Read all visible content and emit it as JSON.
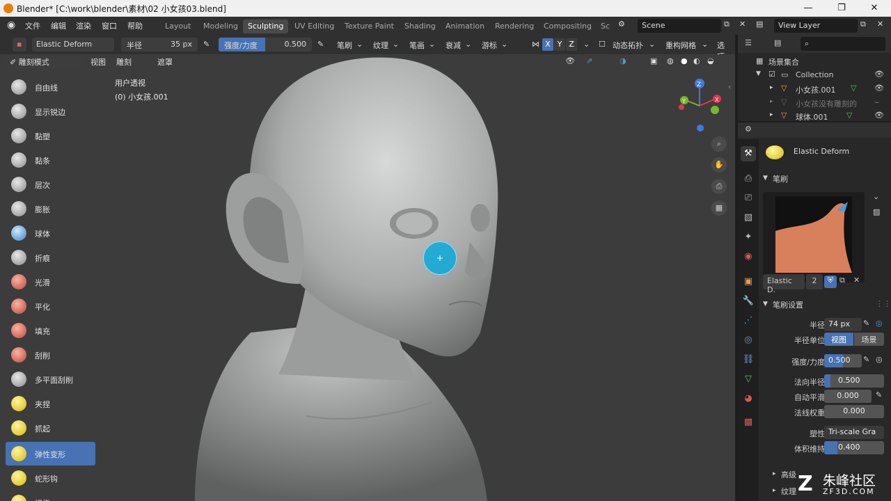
{
  "titlebar": {
    "title": "Blender* [C:\\work\\blender\\素材\\02 小女孩03.blend]",
    "min": "—",
    "max": "❐",
    "close": "✕"
  },
  "menu": [
    "文件",
    "编辑",
    "渲染",
    "窗口",
    "帮助"
  ],
  "workspaces": [
    "Layout",
    "Modeling",
    "Sculpting",
    "UV Editing",
    "Texture Paint",
    "Shading",
    "Animation",
    "Rendering",
    "Compositing",
    "Sc"
  ],
  "scene": "Scene",
  "view_layer": "View Layer",
  "tool_header": {
    "brush_name": "Elastic Deform",
    "radius_label": "半径",
    "radius_value": "35 px",
    "strength_label": "强度/力度",
    "strength_value": "0.500",
    "strength_fraction": 0.5,
    "dropdowns": [
      "笔刷",
      "纹理",
      "笔画",
      "衰减",
      "游标"
    ],
    "axes": [
      "X",
      "Y",
      "Z"
    ],
    "dyntopo": "动态拓扑",
    "remesh": "重构网格",
    "options": "选项"
  },
  "view_header": {
    "mode": "雕刻模式",
    "menus": [
      "视图",
      "雕刻",
      "遮罩"
    ]
  },
  "viewport": {
    "view_name": "用户透视",
    "object_name": "(0) 小女孩.001"
  },
  "tools": [
    {
      "label": "自由线",
      "icon": "draw-icon"
    },
    {
      "label": "显示锐边",
      "icon": "draw-sharp-icon"
    },
    {
      "label": "黏塑",
      "icon": "clay-icon"
    },
    {
      "label": "黏条",
      "icon": "clay-strips-icon"
    },
    {
      "label": "层次",
      "icon": "layer-icon"
    },
    {
      "label": "膨胀",
      "icon": "inflate-icon"
    },
    {
      "label": "球体",
      "icon": "blob-icon"
    },
    {
      "label": "折痕",
      "icon": "crease-icon"
    },
    {
      "label": "光滑",
      "icon": "smooth-icon"
    },
    {
      "label": "平化",
      "icon": "flatten-icon"
    },
    {
      "label": "填充",
      "icon": "fill-icon"
    },
    {
      "label": "刮削",
      "icon": "scrape-icon"
    },
    {
      "label": "多平面刮削",
      "icon": "multiplane-scrape-icon"
    },
    {
      "label": "夹捏",
      "icon": "pinch-icon"
    },
    {
      "label": "抓起",
      "icon": "grab-icon"
    },
    {
      "label": "弹性变形",
      "icon": "elastic-deform-icon"
    },
    {
      "label": "蛇形钩",
      "icon": "snake-hook-icon"
    },
    {
      "label": "拇指",
      "icon": "thumb-icon"
    }
  ],
  "outliner": {
    "root": "场景集合",
    "collection": "Collection",
    "items": [
      "小女孩.001",
      "小女孩没有雕刻的",
      "球体.001"
    ]
  },
  "properties": {
    "brush_name": "Elastic Deform",
    "brush_section": "笔刷",
    "brush_slot_name": "Elastic D.",
    "brush_users": "2",
    "settings_section": "笔刷设置",
    "rows": {
      "radius": {
        "label": "半径",
        "value": "74 px"
      },
      "radius_unit": {
        "label": "半径单位",
        "opt1": "视图",
        "opt2": "场景"
      },
      "strength": {
        "label": "强度/力度",
        "value": "0.500",
        "fraction": 0.5
      },
      "normal_radius": {
        "label": "法向半径",
        "value": "0.500",
        "fraction": 0.5
      },
      "autosmooth": {
        "label": "自动平滑",
        "value": "0.000"
      },
      "normal_weight": {
        "label": "法线权重",
        "value": "0.000"
      },
      "deform": {
        "label": "塑性",
        "value": "Tri-scale Gra"
      },
      "volume": {
        "label": "体积维持",
        "value": "0.400",
        "fraction": 0.4
      }
    },
    "advanced": "高级",
    "texture": "纹理"
  },
  "watermark": {
    "brand": "朱峰社区",
    "url": "ZF3D.COM"
  }
}
